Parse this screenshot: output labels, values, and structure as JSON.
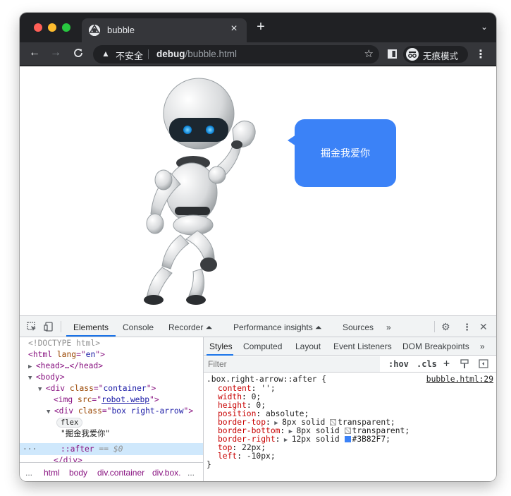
{
  "tab": {
    "title": "bubble",
    "close": "×",
    "new_tab": "+",
    "menu": "⌄"
  },
  "toolbar": {
    "back": "←",
    "forward": "→",
    "reload": "C",
    "warning_icon": "▲",
    "insecure_label": "不安全",
    "url_host": "debug",
    "url_path": "/bubble.html",
    "star": "☆",
    "incognito_label": "无痕模式",
    "menu": "⋮"
  },
  "page": {
    "bubble_text": "掘金我爱你",
    "bubble_color": "#3B82F7"
  },
  "devtools": {
    "tabs": [
      "Elements",
      "Console",
      "Recorder ⏶",
      "Performance insights ⏶",
      "Sources",
      "»"
    ],
    "active_tab": "Elements",
    "elements_tree": {
      "doctype": "<!DOCTYPE html>",
      "html_open": "html",
      "html_lang": "en",
      "head": "<head>…</head>",
      "body": "body",
      "div_container_class": "container",
      "img_src": "robot.webp",
      "div_box_class": "box right-arrow",
      "flex_badge": "flex",
      "text_node": "\"掘金我爱你\"",
      "after_pseudo": "::after",
      "after_eq": "== $0",
      "div_close": "</div>"
    },
    "breadcrumbs": [
      "...",
      "html",
      "body",
      "div.container",
      "div.box.",
      "..."
    ],
    "styles_tabs": [
      "Styles",
      "Computed",
      "Layout",
      "Event Listeners",
      "DOM Breakpoints",
      "»"
    ],
    "filter_placeholder": "Filter",
    "hov": ":hov",
    "cls": ".cls",
    "rule": {
      "selector": ".box.right-arrow::after {",
      "source": "bubble.html:29",
      "declarations": [
        {
          "prop": "content",
          "value": "'';"
        },
        {
          "prop": "width",
          "value": "0;"
        },
        {
          "prop": "height",
          "value": "0;"
        },
        {
          "prop": "position",
          "value": "absolute;"
        },
        {
          "prop": "border-top",
          "value": "8px solid ",
          "swatch": "transparent",
          "after": "transparent;"
        },
        {
          "prop": "border-bottom",
          "value": "8px solid ",
          "swatch": "transparent",
          "after": "transparent;"
        },
        {
          "prop": "border-right",
          "value": "12px solid ",
          "swatch": "blue",
          "after": "#3B82F7;"
        },
        {
          "prop": "top",
          "value": "22px;"
        },
        {
          "prop": "left",
          "value": "-10px;"
        }
      ],
      "close": "}"
    }
  }
}
